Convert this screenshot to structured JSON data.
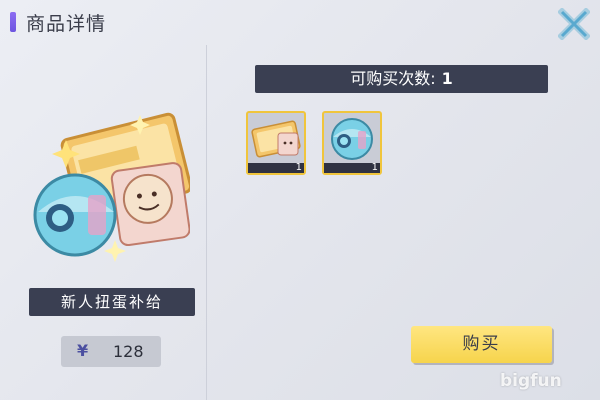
{
  "header": {
    "title": "商品详情"
  },
  "product": {
    "name": "新人扭蛋补给",
    "currency_symbol": "¥",
    "price": "128"
  },
  "purchase": {
    "count_label": "可购买次数:",
    "count_value": "1"
  },
  "items": [
    {
      "icon": "ticket-card-icon",
      "qty": "1"
    },
    {
      "icon": "capsule-ball-icon",
      "qty": "1"
    }
  ],
  "buttons": {
    "buy_label": "购买"
  },
  "watermark": "bigfun",
  "colors": {
    "accent": "#7a5ee8",
    "dark_plate": "#3a3f52",
    "buy_yellow": "#f6d44c",
    "item_border": "#f0c53c"
  }
}
